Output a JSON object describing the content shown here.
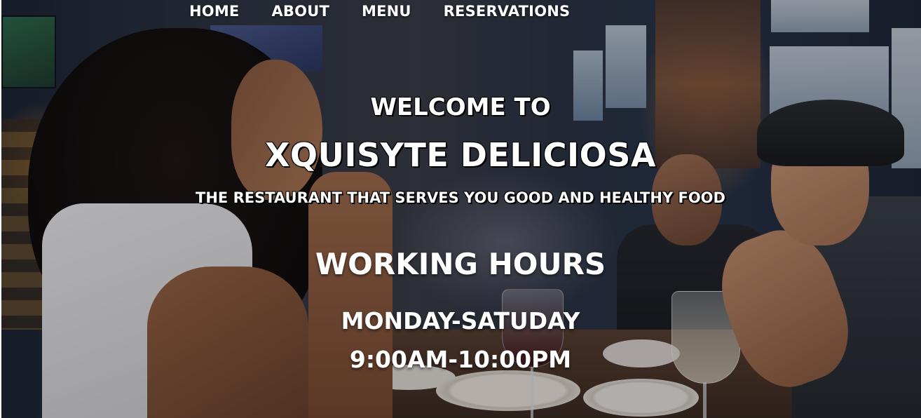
{
  "nav": {
    "items": [
      {
        "label": "HOME"
      },
      {
        "label": "ABOUT"
      },
      {
        "label": "MENU"
      },
      {
        "label": "RESERVATIONS"
      }
    ]
  },
  "hero": {
    "welcome": "WELCOME TO",
    "brand": "XQUISYTE DELICIOSA",
    "tagline": "THE RESTAURANT THAT SERVES YOU GOOD AND HEALTHY FOOD"
  },
  "hours": {
    "title": "WORKING HOURS",
    "days": "MONDAY-SATUDAY",
    "time": "9:00AM-10:00PM"
  },
  "colors": {
    "text": "#ffffff",
    "outline": "#000000"
  }
}
